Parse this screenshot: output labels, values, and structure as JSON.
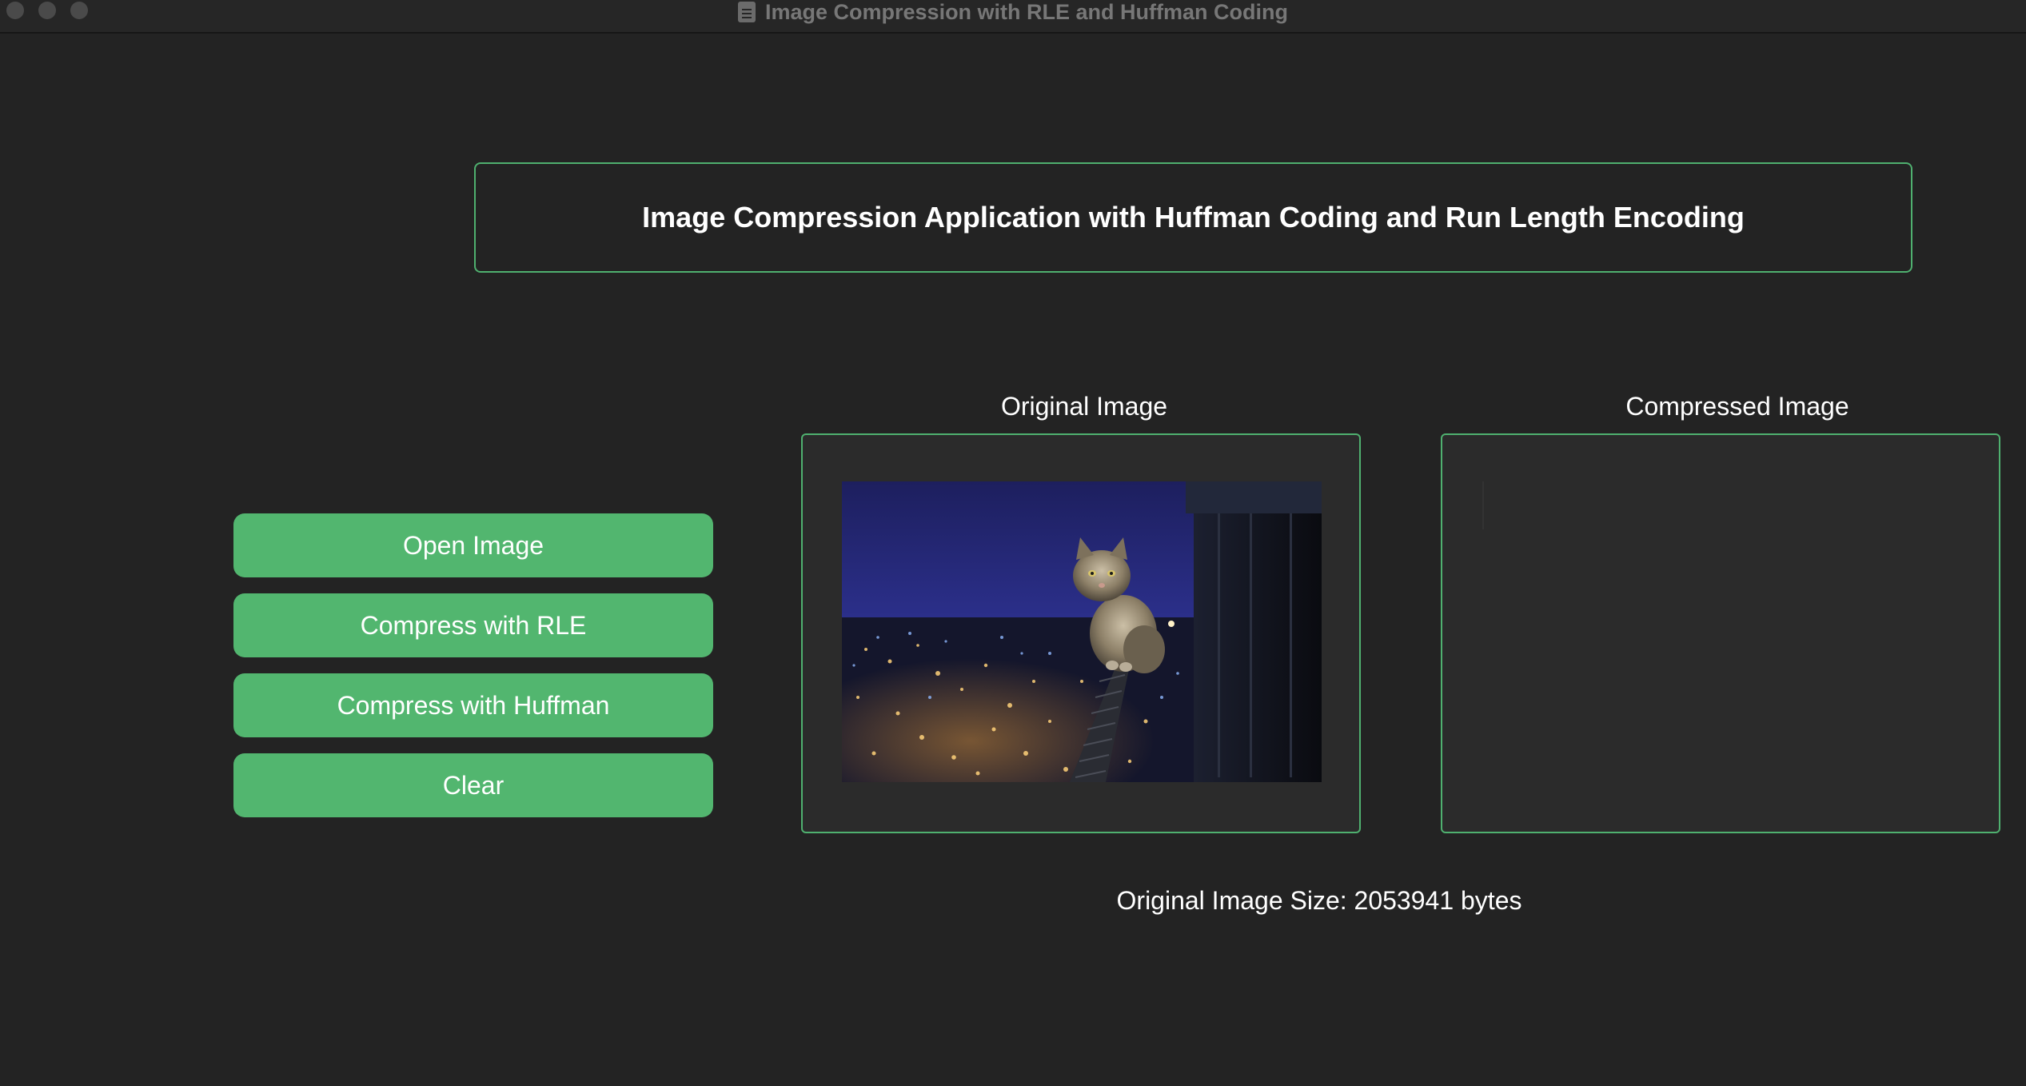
{
  "window": {
    "title": "Image Compression with RLE and Huffman Coding"
  },
  "header": {
    "title": "Image Compression Application with Huffman Coding and Run Length Encoding"
  },
  "buttons": {
    "open": "Open Image",
    "rle": "Compress with RLE",
    "huffman": "Compress with Huffman",
    "clear": "Clear"
  },
  "panels": {
    "original_label": "Original Image",
    "compressed_label": "Compressed Image"
  },
  "status": {
    "original_size": "Original Image Size: 2053941 bytes"
  },
  "colors": {
    "background": "#232323",
    "accent": "#52b66f",
    "border": "#4fb06f",
    "panel": "#2b2b2b"
  },
  "icons": [
    "document-icon",
    "cat-photo"
  ]
}
